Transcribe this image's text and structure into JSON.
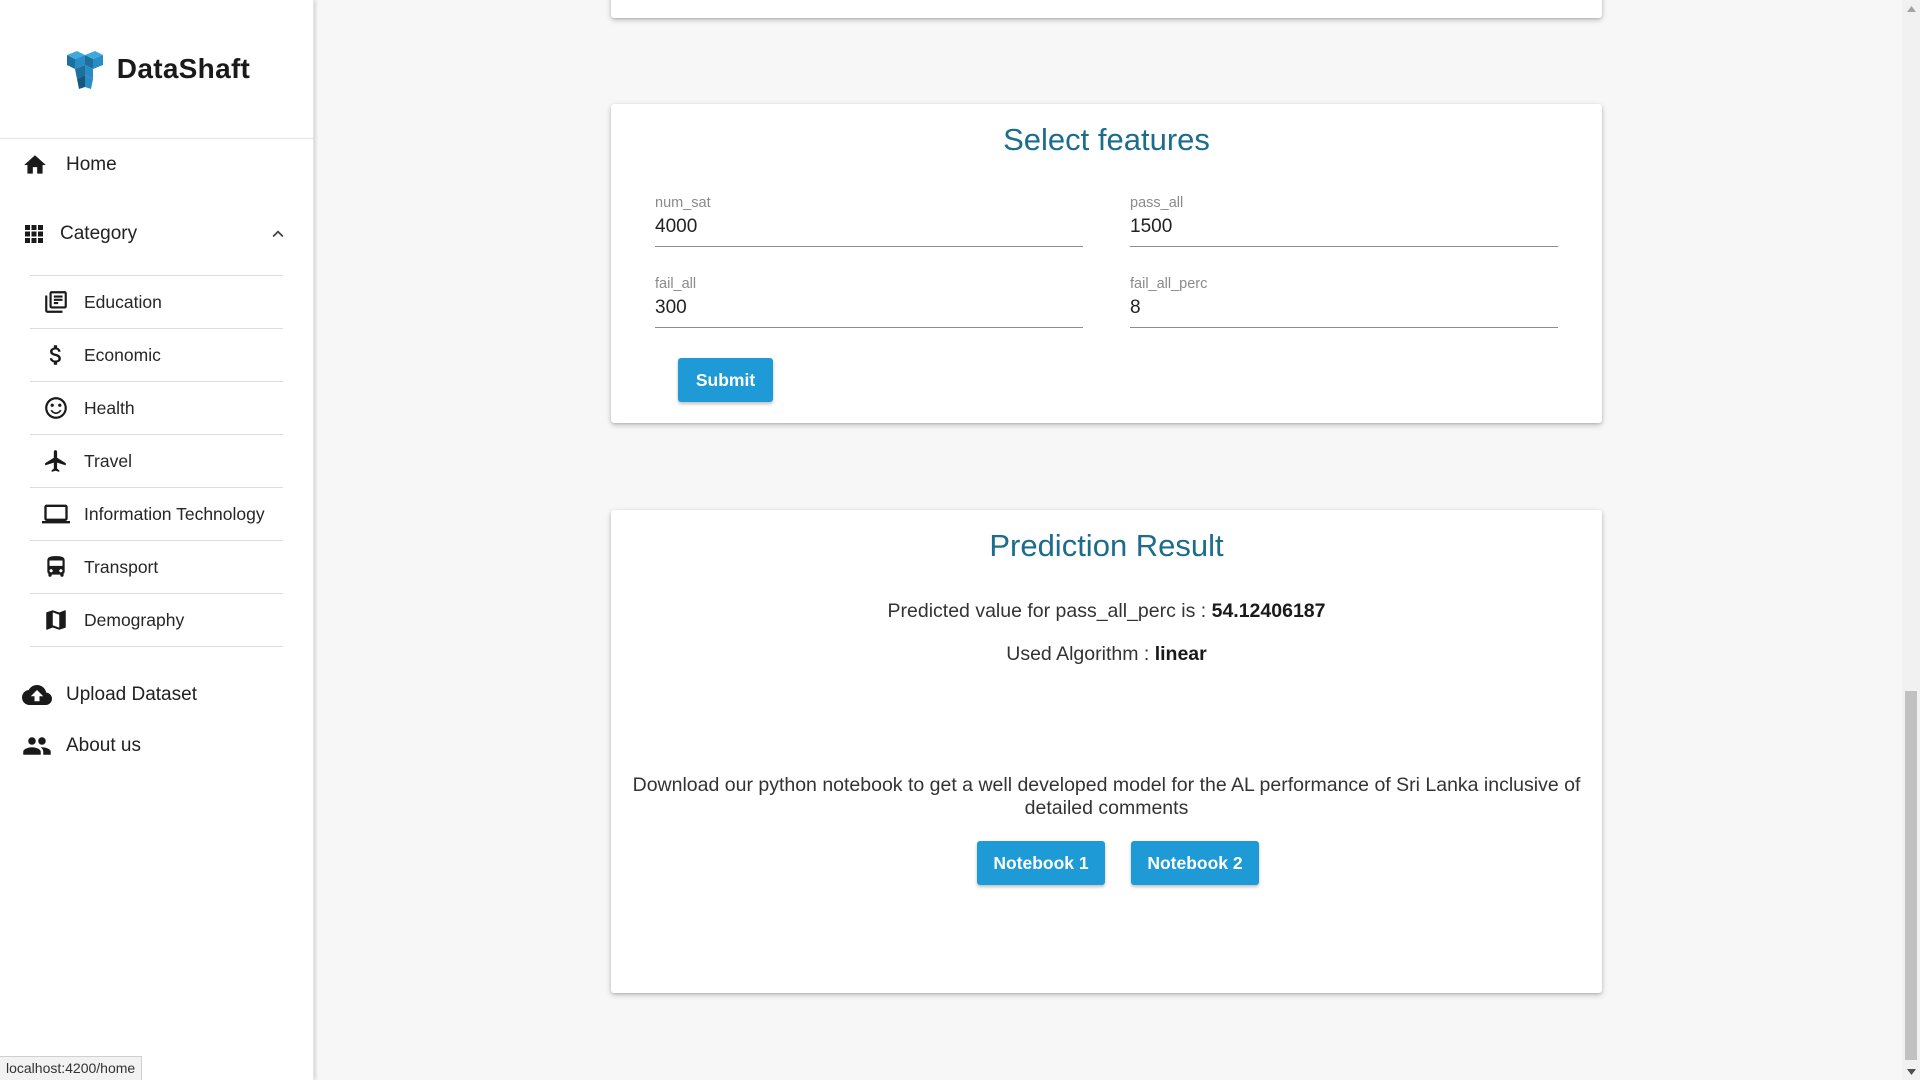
{
  "brand": {
    "name": "DataShaft"
  },
  "nav": {
    "home": "Home",
    "category": "Category",
    "sub_items": [
      {
        "label": "Education",
        "icon": "newspaper-icon"
      },
      {
        "label": "Economic",
        "icon": "dollar-icon"
      },
      {
        "label": "Health",
        "icon": "smiley-icon"
      },
      {
        "label": "Travel",
        "icon": "airplane-icon"
      },
      {
        "label": "Information Technology",
        "icon": "laptop-icon"
      },
      {
        "label": "Transport",
        "icon": "bus-icon"
      },
      {
        "label": "Demography",
        "icon": "map-icon"
      }
    ],
    "upload": "Upload Dataset",
    "about": "About us"
  },
  "features": {
    "title": "Select features",
    "fields": [
      {
        "label": "num_sat",
        "value": "4000"
      },
      {
        "label": "pass_all",
        "value": "1500"
      },
      {
        "label": "fail_all",
        "value": "300"
      },
      {
        "label": "fail_all_perc",
        "value": "8"
      }
    ],
    "submit_label": "Submit"
  },
  "result": {
    "title": "Prediction Result",
    "predicted_prefix": "Predicted value for pass_all_perc is : ",
    "predicted_value": "54.12406187",
    "algorithm_prefix": "Used Algorithm : ",
    "algorithm_value": "linear",
    "download_text": "Download our python notebook to get a well developed model for the AL performance of Sri Lanka inclusive of detailed comments",
    "notebook1_label": "Notebook 1",
    "notebook2_label": "Notebook 2"
  },
  "status_url": "localhost:4200/home",
  "colors": {
    "accent": "#1e9bd7",
    "title": "#1b6c8d",
    "logo": "#1f8ec9"
  }
}
